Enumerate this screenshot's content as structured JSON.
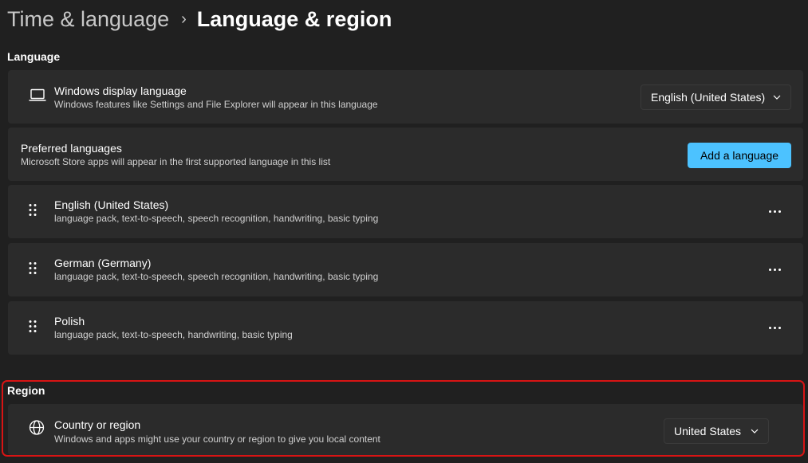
{
  "breadcrumb": {
    "parent": "Time & language",
    "separator": "›",
    "current": "Language & region"
  },
  "language_section": {
    "title": "Language",
    "display_language": {
      "title": "Windows display language",
      "description": "Windows features like Settings and File Explorer will appear in this language",
      "selected": "English (United States)",
      "icon": "laptop-icon"
    },
    "preferred": {
      "title": "Preferred languages",
      "description": "Microsoft Store apps will appear in the first supported language in this list",
      "button_label": "Add a language"
    },
    "languages": [
      {
        "name": "English (United States)",
        "features": "language pack, text-to-speech, speech recognition, handwriting, basic typing"
      },
      {
        "name": "German (Germany)",
        "features": "language pack, text-to-speech, speech recognition, handwriting, basic typing"
      },
      {
        "name": "Polish",
        "features": "language pack, text-to-speech, handwriting, basic typing"
      }
    ]
  },
  "region_section": {
    "title": "Region",
    "country": {
      "title": "Country or region",
      "description": "Windows and apps might use your country or region to give you local content",
      "selected": "United States",
      "icon": "globe-icon"
    },
    "highlight_color": "#d81414"
  },
  "colors": {
    "background": "#202020",
    "card": "#2b2b2b",
    "accent": "#4cc2ff"
  }
}
